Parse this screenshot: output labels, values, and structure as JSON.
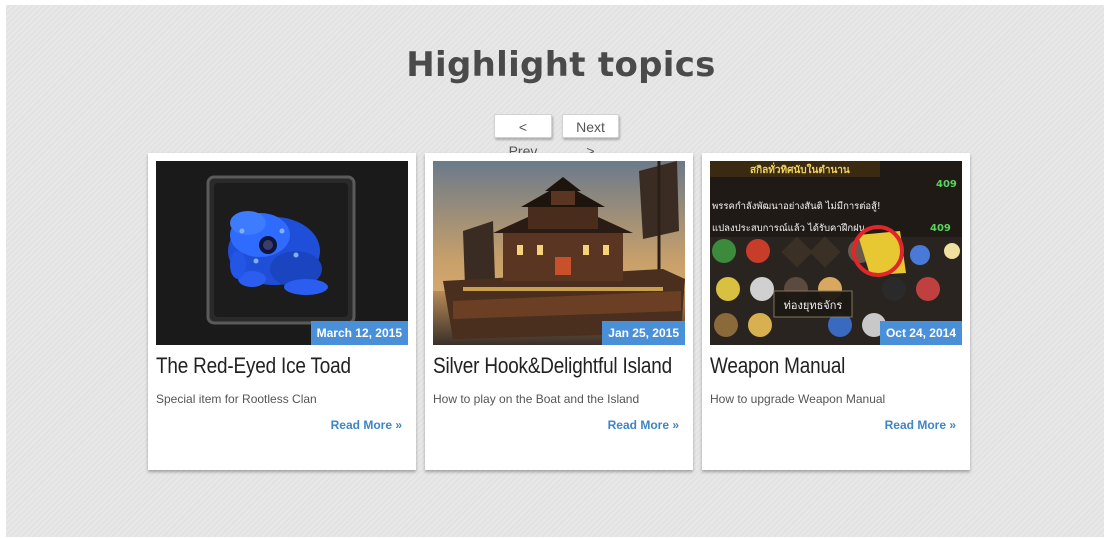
{
  "section": {
    "title": "Highlight topics",
    "prev_label": "< Prev",
    "next_label": "Next >"
  },
  "colors": {
    "badge": "#4a90d9",
    "link": "#3d85c6",
    "background": "#e6e6e6"
  },
  "cards": [
    {
      "image": "blue-ice-toad-image",
      "date": "March 12, 2015",
      "title": "The Red-Eyed Ice Toad",
      "description": "Special item for Rootless Clan",
      "read_more": "Read More »"
    },
    {
      "image": "chinese-junk-ship-image",
      "date": "Jan 25, 2015",
      "title": "Silver Hook&Delightful Island",
      "description": "How to play on the Boat and the Island",
      "read_more": "Read More »"
    },
    {
      "image": "game-skill-menu-screenshot",
      "date": "Oct 24, 2014",
      "title": "Weapon Manual",
      "description": "How to upgrade Weapon Manual",
      "read_more": "Read More »",
      "image_text": {
        "line1": "สกิลทั่วทิศนับในตำนาน",
        "line2": "พรรคกำลังพัฒนาอย่างสันติ ไม่มีการต่อสู้!",
        "line3": "แปลงประสบการณ์แล้ว ได้รับคาฝึกฝน",
        "stat1": "409",
        "stat2": "409",
        "tooltip": "ท่องยุทธจักร"
      }
    }
  ]
}
